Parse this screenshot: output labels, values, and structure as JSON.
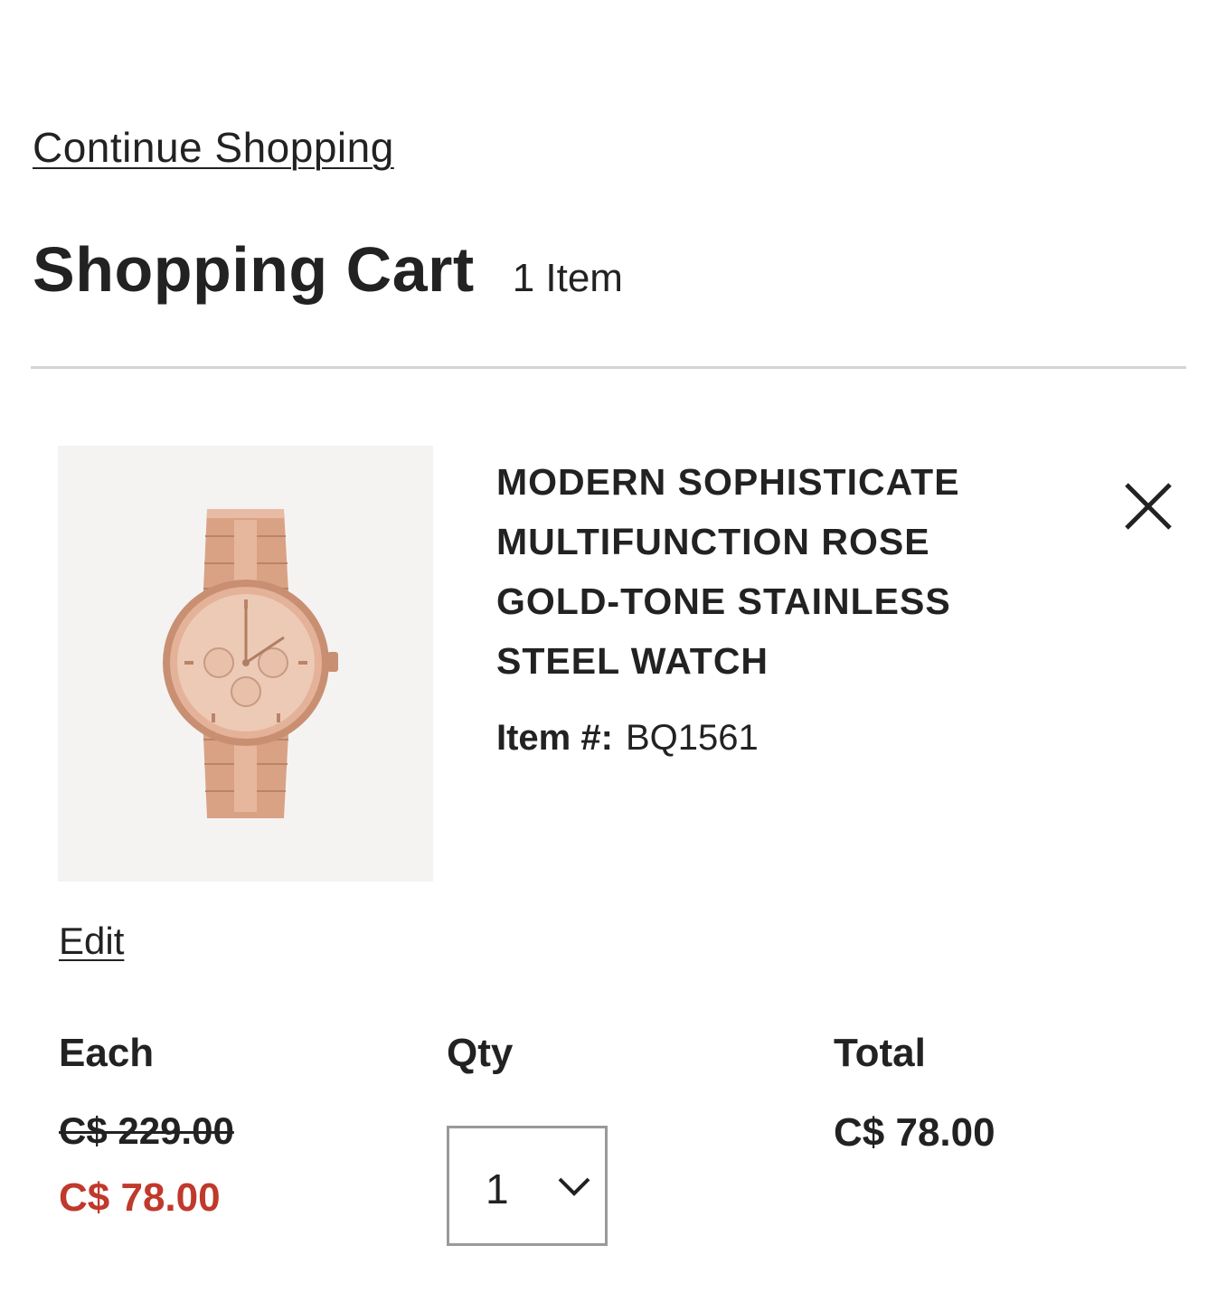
{
  "nav": {
    "continue_label": "Continue Shopping"
  },
  "cart": {
    "title": "Shopping Cart",
    "count": "1 Item"
  },
  "item": {
    "image_icon": "watch-image",
    "name_lines": [
      "MODERN SOPHISTICATE",
      "MULTIFUNCTION ROSE",
      "GOLD-TONE STAINLESS",
      "STEEL WATCH"
    ],
    "number_label": "Item #:",
    "number_value": "BQ1561",
    "remove_icon": "close-icon",
    "edit_label": "Edit"
  },
  "pricing": {
    "each_label": "Each",
    "qty_label": "Qty",
    "total_label": "Total",
    "original_price": "C$ 229.00",
    "sale_price": "C$ 78.00",
    "qty_value": "1",
    "qty_icon": "chevron-down-icon",
    "total_price": "C$ 78.00"
  },
  "colors": {
    "text": "#222222",
    "sale": "#c0392b",
    "divider": "#d4d4d4",
    "select_border": "#9a9a9a",
    "image_bg": "#f5f3f2",
    "watch_rose_gold": "#d9a285"
  }
}
